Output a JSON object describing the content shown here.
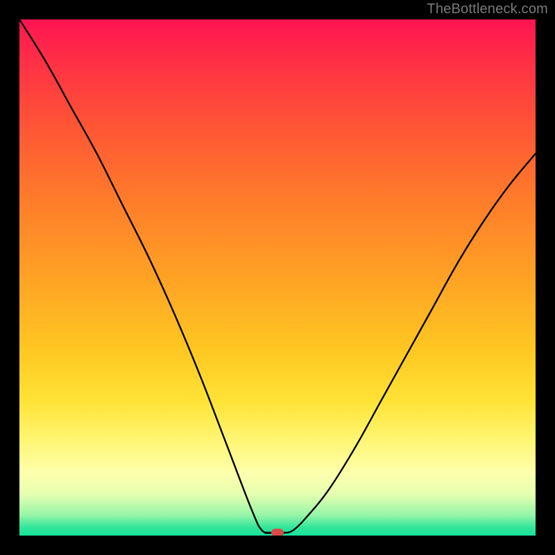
{
  "watermark": "TheBottleneck.com",
  "colors": {
    "frame": "#000000",
    "watermark": "#7a7a7a",
    "curve": "#000000",
    "dot": "#d94a4a",
    "gradient_top": "#ff1452",
    "gradient_bottom": "#18e39b"
  },
  "chart_data": {
    "type": "line",
    "title": "",
    "xlabel": "",
    "ylabel": "",
    "xlim": [
      0,
      100
    ],
    "ylim": [
      0,
      100
    ],
    "grid": false,
    "legend": false,
    "series": [
      {
        "name": "bottleneck-curve",
        "x": [
          0,
          5,
          10,
          15,
          20,
          25,
          30,
          35,
          40,
          45,
          47,
          49,
          51,
          53,
          56,
          60,
          65,
          70,
          75,
          80,
          85,
          90,
          95,
          100
        ],
        "y": [
          100,
          92,
          83,
          74,
          64,
          54,
          43,
          31,
          18,
          5,
          1,
          0,
          0,
          1,
          4,
          9,
          17,
          26,
          35,
          44,
          53,
          61,
          68,
          74
        ]
      }
    ],
    "marker": {
      "name": "optimal-point",
      "x": 50,
      "y": 0
    },
    "annotations": []
  }
}
